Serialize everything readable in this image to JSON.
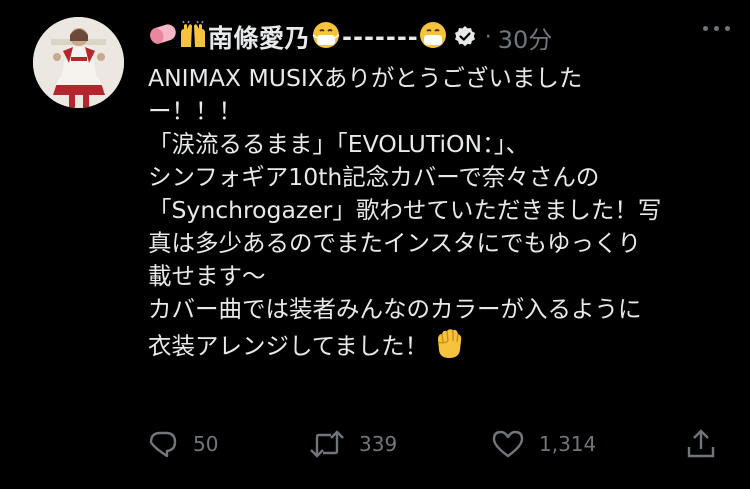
{
  "tweet": {
    "author": {
      "display_name": "南條愛乃",
      "name_decoration": "-------",
      "verified": true,
      "avatar": "avatar-photo"
    },
    "time_separator": "·",
    "timestamp": "30分",
    "more_icon": "more-horizontal-icon",
    "text_lines": [
      "ANIMAX MUSIXありがとうございました",
      "ー！！！",
      "「涙流るるまま」「EVOLUTiON：」、",
      "シンフォギア10th記念カバーで奈々さんの",
      "「Synchrogazer」歌わせていただきました！写",
      "真は多少あるのでまたインスタにでもゆっくり",
      "載せます〜",
      "カバー曲では装者みんなのカラーが入るように",
      "衣装アレンジしてました！"
    ],
    "actions": {
      "reply": {
        "icon": "reply-icon",
        "count": "50"
      },
      "retweet": {
        "icon": "retweet-icon",
        "count": "339"
      },
      "like": {
        "icon": "heart-icon",
        "count": "1,314"
      },
      "share": {
        "icon": "share-icon"
      }
    }
  },
  "colors": {
    "background": "#000000",
    "text": "#e7e9ea",
    "secondary": "#71767b"
  }
}
